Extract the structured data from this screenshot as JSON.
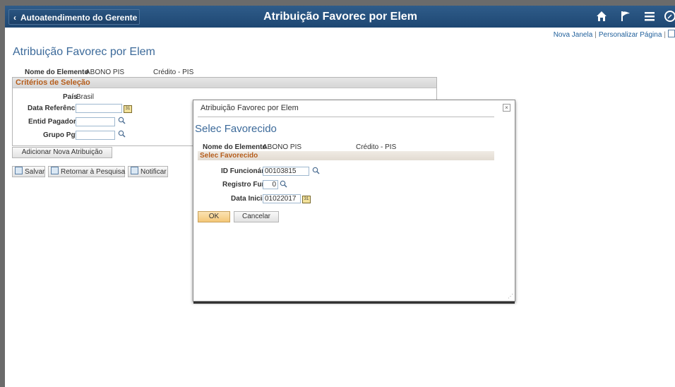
{
  "header": {
    "back_label": "Autoatendimento do Gerente",
    "title": "Atribuição Favorec por Elem",
    "icons": [
      "home-icon",
      "flag-icon",
      "menu-icon",
      "navbar-icon"
    ]
  },
  "links": {
    "new_window": "Nova Janela",
    "personalize": "Personalizar Página"
  },
  "page": {
    "title": "Atribuição Favorec por Elem",
    "element_label": "Nome do Elemento",
    "element_code": "ABONO PIS",
    "element_desc": "Crédito - PIS",
    "criteria": {
      "header": "Critérios de Seleção",
      "pais_label": "País",
      "pais_value": "Brasil",
      "data_ref_label": "Data Referência",
      "data_ref_value": "",
      "entid_label": "Entid Pagadora",
      "entid_value": "",
      "grupo_label": "Grupo Pgto",
      "grupo_value": ""
    },
    "add_button": "Adicionar Nova Atribuição",
    "toolbar": {
      "save": "Salvar",
      "return": "Retornar à Pesquisa",
      "notify": "Notificar"
    }
  },
  "modal": {
    "window_title": "Atribuição Favorec por Elem",
    "close": "×",
    "heading": "Selec Favorecido",
    "element_label": "Nome do Elemento",
    "element_code": "ABONO PIS",
    "element_desc": "Crédito - PIS",
    "section_header": "Selec Favorecido",
    "id_label": "ID Funcionário",
    "id_value": "00103815",
    "reg_label": "Registro Func",
    "reg_value": "0",
    "date_label": "Data Inicial",
    "date_value": "01022017",
    "ok": "OK",
    "cancel": "Cancelar"
  },
  "colors": {
    "header_bg": "#2f5c8a",
    "title_blue": "#3c6a9a",
    "section_orange": "#b55d1b",
    "ok_button": "#f4c777"
  }
}
